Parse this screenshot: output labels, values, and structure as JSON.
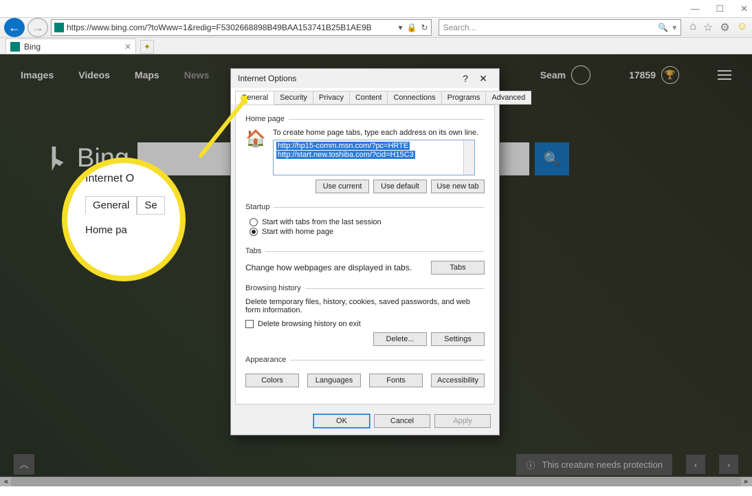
{
  "windowControls": {
    "min": "—",
    "max": "☐",
    "close": "✕"
  },
  "ieToolbar": {
    "url": "https://www.bing.com/?toWww=1&redig=F5302668898B49BAA153741B25B1AE9B",
    "protocolBold": "https",
    "hostBold": "www.bing.com",
    "refreshIcon": "↻",
    "stopIcon": "✕",
    "dropdownIcon": "▾",
    "lockIcon": "🔒",
    "searchPlaceholder": "Search...",
    "searchGlass": "🔍",
    "searchDrop": "▾",
    "icons": {
      "home": "⌂",
      "star": "☆",
      "gear": "⚙",
      "smiley": "☺"
    }
  },
  "browserTab": {
    "title": "Bing",
    "closeIcon": "✕",
    "newTabIcon": "✦"
  },
  "bing": {
    "nav": [
      "Images",
      "Videos",
      "Maps",
      "News"
    ],
    "user": {
      "name": "Seam",
      "points": "17859",
      "trophy": "🏆",
      "hamburger": true
    },
    "logoText": "Bing",
    "searchGlass": "🔍",
    "bottom": {
      "infoText": "This creature needs protection",
      "pin": "📌",
      "chevUp": "︿",
      "i": "ⓘ",
      "chevLeft": "‹",
      "chevRight": "›"
    }
  },
  "zoom": {
    "title": "Internet O",
    "tabs": [
      "General",
      "Se"
    ],
    "section": "Home pa"
  },
  "dialog": {
    "title": "Internet Options",
    "help": "?",
    "close": "✕",
    "tabs": [
      "General",
      "Security",
      "Privacy",
      "Content",
      "Connections",
      "Programs",
      "Advanced"
    ],
    "activeTab": "General",
    "homepage": {
      "legend": "Home page",
      "instruction": "To create home page tabs, type each address on its own line.",
      "lines": [
        "http://hp15-comm.msn.com/?pc=HRTE",
        "http://start.new.toshiba.com/?cid=H15C3"
      ],
      "buttons": [
        "Use current",
        "Use default",
        "Use new tab"
      ]
    },
    "startup": {
      "legend": "Startup",
      "optLast": "Start with tabs from the last session",
      "optHome": "Start with home page",
      "selected": "home"
    },
    "tabsSection": {
      "legend": "Tabs",
      "text": "Change how webpages are displayed in tabs.",
      "button": "Tabs"
    },
    "history": {
      "legend": "Browsing history",
      "text": "Delete temporary files, history, cookies, saved passwords, and web form information.",
      "checkbox": "Delete browsing history on exit",
      "buttons": [
        "Delete...",
        "Settings"
      ]
    },
    "appearance": {
      "legend": "Appearance",
      "buttons": [
        "Colors",
        "Languages",
        "Fonts",
        "Accessibility"
      ]
    },
    "footer": {
      "ok": "OK",
      "cancel": "Cancel",
      "apply": "Apply"
    }
  }
}
